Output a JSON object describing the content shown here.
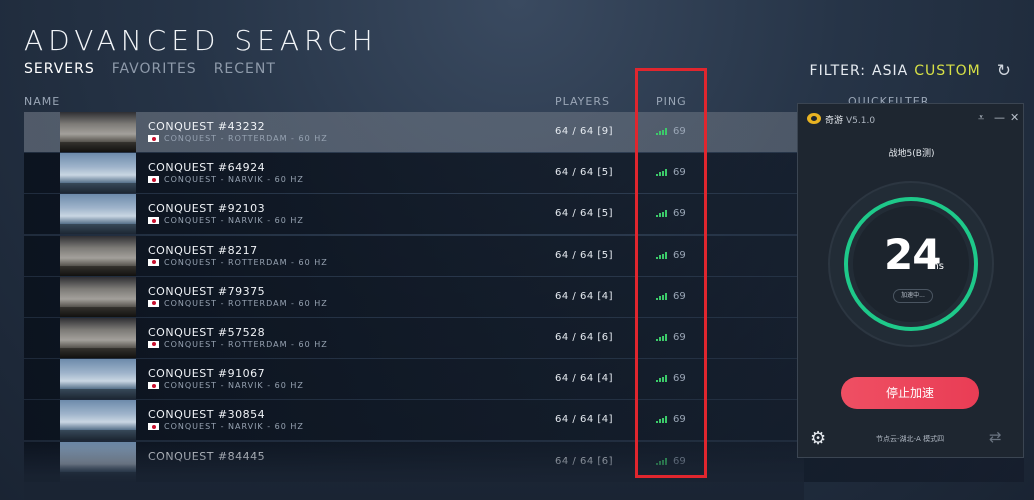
{
  "title": "ADVANCED SEARCH",
  "tabs": [
    {
      "label": "SERVERS"
    },
    {
      "label": "FAVORITES"
    },
    {
      "label": "RECENT"
    }
  ],
  "filter": {
    "prefix": "FILTER:",
    "region": "ASIA",
    "mode": "CUSTOM"
  },
  "columns": {
    "name": "NAME",
    "players": "PLAYERS",
    "ping": "PING",
    "quickfilter": "QUICKFILTER"
  },
  "servers": [
    {
      "name": "CONQUEST #43232",
      "details": "CONQUEST - ROTTERDAM - 60 HZ",
      "map": "rotterdam",
      "players": "64 / 64 [9]",
      "ping": "69"
    },
    {
      "name": "CONQUEST #64924",
      "details": "CONQUEST - NARVIK - 60 HZ",
      "map": "narvik",
      "players": "64 / 64 [5]",
      "ping": "69"
    },
    {
      "name": "CONQUEST #92103",
      "details": "CONQUEST - NARVIK - 60 HZ",
      "map": "narvik",
      "players": "64 / 64 [5]",
      "ping": "69"
    },
    {
      "name": "CONQUEST #8217",
      "details": "CONQUEST - ROTTERDAM - 60 HZ",
      "map": "rotterdam",
      "players": "64 / 64 [5]",
      "ping": "69"
    },
    {
      "name": "CONQUEST #79375",
      "details": "CONQUEST - ROTTERDAM - 60 HZ",
      "map": "rotterdam",
      "players": "64 / 64 [4]",
      "ping": "69"
    },
    {
      "name": "CONQUEST #57528",
      "details": "CONQUEST - ROTTERDAM - 60 HZ",
      "map": "rotterdam",
      "players": "64 / 64 [6]",
      "ping": "69"
    },
    {
      "name": "CONQUEST #91067",
      "details": "CONQUEST - NARVIK - 60 HZ",
      "map": "narvik",
      "players": "64 / 64 [4]",
      "ping": "69"
    },
    {
      "name": "CONQUEST #30854",
      "details": "CONQUEST - NARVIK - 60 HZ",
      "map": "narvik",
      "players": "64 / 64 [4]",
      "ping": "69"
    },
    {
      "name": "CONQUEST #84445",
      "details": "",
      "map": "narvik",
      "players": "64 / 64 [6]",
      "ping": "69"
    }
  ],
  "booster": {
    "brand": "奇游",
    "version": "V5.1.0",
    "game": "战地5(B测)",
    "latency": "24",
    "unit": "ms",
    "status": "加速中...",
    "stop_label": "停止加速",
    "node": "节点云-湖北-A 模式四"
  },
  "colors": {
    "accent": "#d7e046",
    "ping_bars": "#3ccb6a",
    "highlight": "#e0262e",
    "stop_button": "#e93d55",
    "gauge": "#1ec98a"
  }
}
